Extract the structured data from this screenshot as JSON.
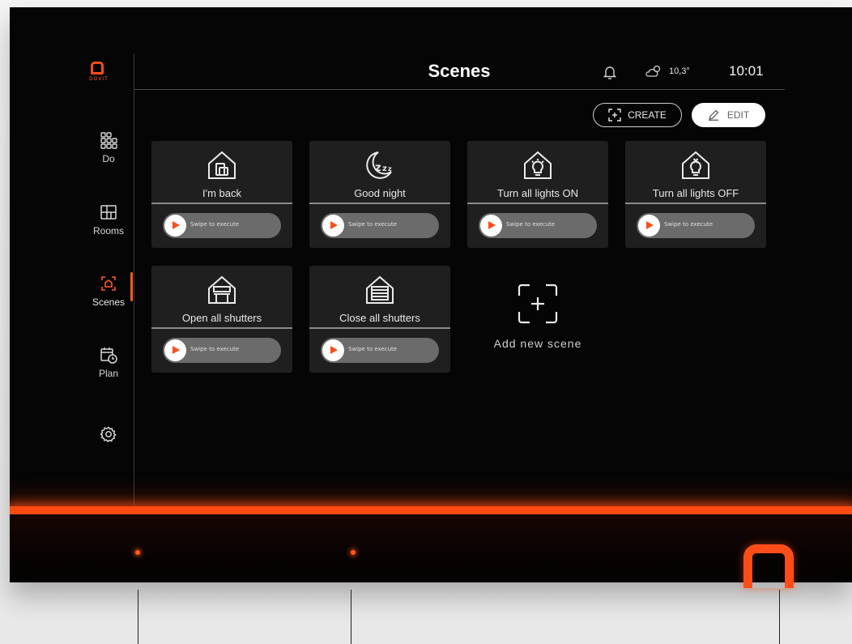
{
  "brand": {
    "logo_text": "DOVIT",
    "accent": "#ff4d1a"
  },
  "sidebar": {
    "items": [
      {
        "label": "Do",
        "icon": "grid-icon"
      },
      {
        "label": "Rooms",
        "icon": "floorplan-icon"
      },
      {
        "label": "Scenes",
        "icon": "scene-icon",
        "active": true
      },
      {
        "label": "Plan",
        "icon": "calendar-clock-icon"
      },
      {
        "label": "",
        "icon": "gear-icon"
      }
    ]
  },
  "header": {
    "title": "Scenes",
    "weather": "10,3°",
    "time": "10:01"
  },
  "toolbar": {
    "create_label": "CREATE",
    "edit_label": "EDIT"
  },
  "scenes": [
    {
      "name": "I'm back",
      "icon": "house-door-icon",
      "action": "Swipe to execute"
    },
    {
      "name": "Good night",
      "icon": "moon-zzz-icon",
      "action": "Swipe to execute"
    },
    {
      "name": "Turn all lights ON",
      "icon": "house-bulb-on-icon",
      "action": "Swipe to execute"
    },
    {
      "name": "Turn all lights OFF",
      "icon": "house-bulb-off-icon",
      "action": "Swipe to execute"
    },
    {
      "name": "Open all shutters",
      "icon": "shutter-open-icon",
      "action": "Swipe to execute"
    },
    {
      "name": "Close all shutters",
      "icon": "shutter-closed-icon",
      "action": "Swipe to execute"
    }
  ],
  "add_scene": {
    "label": "Add new scene"
  }
}
